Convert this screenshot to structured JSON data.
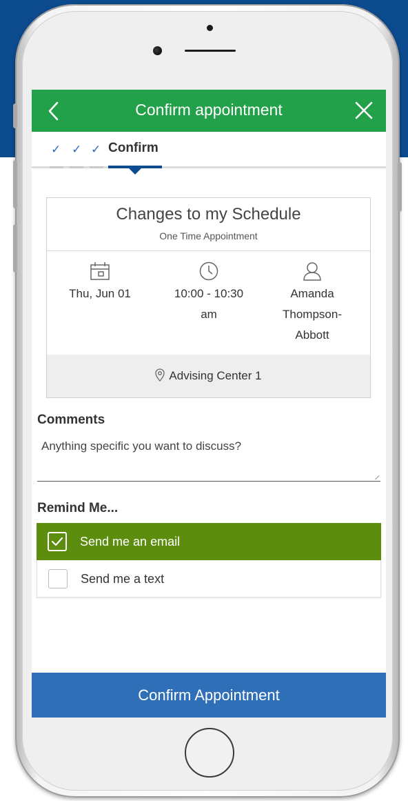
{
  "header": {
    "title": "Confirm appointment"
  },
  "steps": {
    "completed": [
      "✓",
      "✓",
      "✓"
    ],
    "current_label": "Confirm"
  },
  "appointment": {
    "title": "Changes to my Schedule",
    "subtitle": "One Time Appointment",
    "date": "Thu, Jun 01",
    "time_line1": "10:00 - 10:30",
    "time_line2": "am",
    "advisor_line1": "Amanda",
    "advisor_line2": "Thompson-",
    "advisor_line3": "Abbott",
    "location": "Advising Center 1"
  },
  "comments": {
    "heading": "Comments",
    "placeholder": "Anything specific you want to discuss?"
  },
  "remind": {
    "heading": "Remind Me...",
    "options": [
      {
        "label": "Send me an email",
        "checked": true
      },
      {
        "label": "Send me a text",
        "checked": false
      }
    ]
  },
  "footer": {
    "confirm_label": "Confirm Appointment"
  },
  "colors": {
    "brand_green": "#23a04a",
    "selected_option": "#5d8d0e",
    "primary_blue": "#2f6fb8",
    "step_accent": "#0d4b8f",
    "page_background": "#0d4b8f"
  }
}
